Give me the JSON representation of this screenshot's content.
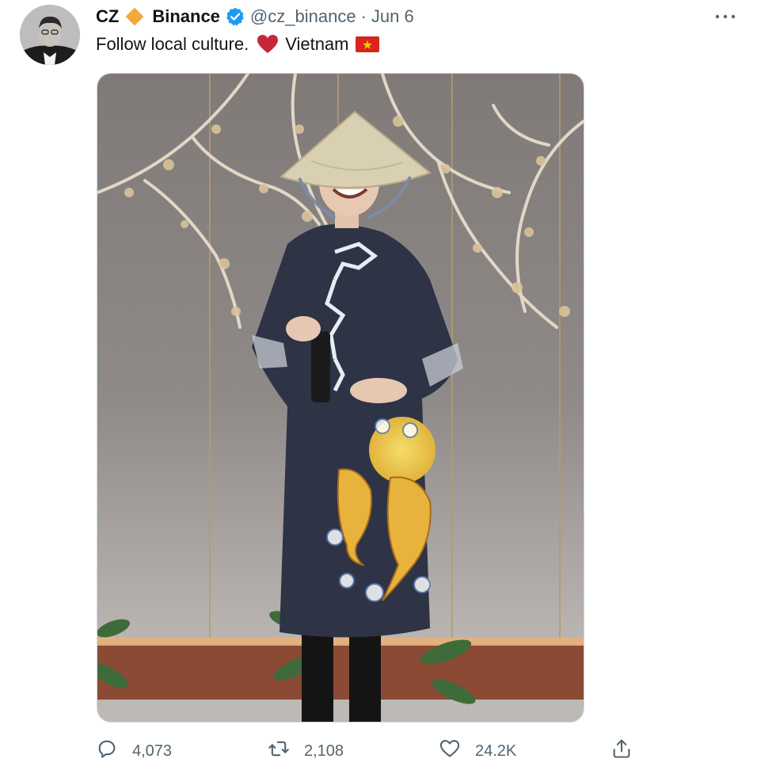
{
  "tweet": {
    "author_name": "CZ",
    "brand_name": "Binance",
    "handle": "@cz_binance",
    "separator": "·",
    "date": "Jun 6",
    "text_main": "Follow local culture.",
    "text_after_heart": "Vietnam",
    "icons": {
      "diamond": "orange-diamond-icon",
      "verified": "verified-badge-icon",
      "more": "more-options-icon",
      "heart": "red-heart-emoji",
      "flag": "vietnam-flag-emoji"
    },
    "colors": {
      "diamond": "#f0a93a",
      "verified": "#1d9bf0",
      "heart": "#c6283a",
      "flag_red": "#da251d",
      "flag_star": "#ffcd00",
      "secondary_text": "#536471"
    }
  },
  "actions": {
    "reply_count": "4,073",
    "retweet_count": "2,108",
    "like_count": "24.2K",
    "icons": [
      "reply-icon",
      "retweet-icon",
      "like-icon",
      "share-icon"
    ]
  }
}
